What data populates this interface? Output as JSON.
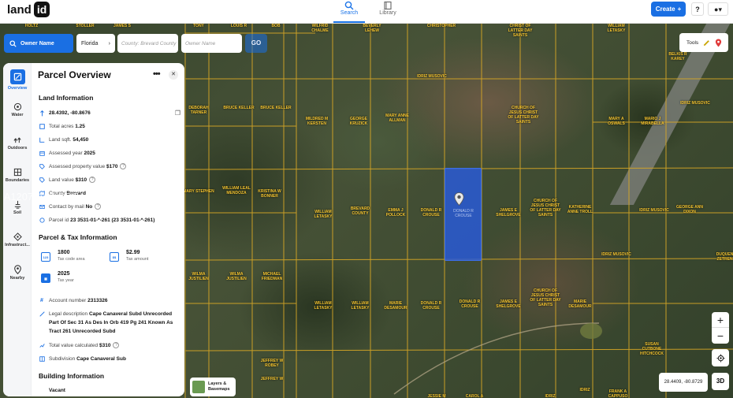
{
  "header": {
    "logo_text": "land",
    "logo_badge": "id",
    "tabs": [
      {
        "label": "Search",
        "active": true
      },
      {
        "label": "Library",
        "active": false
      }
    ],
    "create_label": "Create",
    "help_label": "?",
    "user_icon": "user-icon"
  },
  "search": {
    "mode_label": "Owner Name",
    "state": "Florida",
    "county_placeholder": "County: Brevard County",
    "owner_placeholder": "Owner Name",
    "go_label": "GO"
  },
  "tools": {
    "label": "Tools"
  },
  "map": {
    "selected_label": "DONALD R CROUSE",
    "owners": [
      "HOLTZ",
      "STOLLER",
      "JAMES S",
      "TONY",
      "LOUIS R",
      "BOB",
      "WILFRID CHALME",
      "BEVERLY LEHEW",
      "CHRISTOPHER",
      "CHRIST OF LATTER DAY SAINTS",
      "WILLIAM LETASKY",
      "BELKIS R KAREY",
      "IDRIZ MUSOVIC",
      "DEBORAH TARNER",
      "BRUCE KELLER",
      "BRUCE KELLER",
      "MILDRED M KERSTEN",
      "GEORGE KRUZICK",
      "MARY ANNE ALLMAN",
      "CHURCH OF JESUS CHRIST OF LATTER DAY SAINTS",
      "MARY A OSWALS",
      "MARIO J MIRABELLA",
      "IDRIZ MUSOVIC",
      "MARY STEPHEN",
      "WILLIAM LEAL MENDOZA",
      "KRISTINA W BONNER",
      "WILLIAM LETASKY",
      "BREVARD COUNTY",
      "EMMA J POLLOCK",
      "DONALD R CROUSE",
      "JAMES E SHELGROVE",
      "CHURCH OF JESUS CHRIST OF LATTER DAY SAINTS",
      "KATHERINE ANNE TROLL",
      "IDRIZ MUSOVIC",
      "GEORGE ANN DIXON",
      "IDRIZ MUSOVIC",
      "DUQUENNE ZETRENNE",
      "WILMA JUSTILIEN",
      "WILMA JUSTILIEN",
      "MICHAEL FRIEDMAN",
      "WILLIAM LETASKY",
      "WILLIAM LETASKY",
      "MARIE DESAMOUR",
      "DONALD R CROUSE",
      "DONALD R CROUSE",
      "JAMES E SHELGROVE",
      "CHURCH OF JESUS CHRIST OF LATTER DAY SAINTS",
      "MARIE DESAMOUR",
      "SUSAN CUTBONE HITCHCOCK",
      "JEFFREY W ROBEY",
      "JEFFREY W",
      "JESSIE M",
      "CAROL A",
      "IDRIZ",
      "IDRIZ",
      "FRANK A CAPPUSO"
    ]
  },
  "watermark": "A12071136 ©BEACHESMLS© 2026",
  "coords_readout": "28.4409, -80.8729",
  "layers": {
    "label_line1": "Layers &",
    "label_line2": "Basemaps"
  },
  "controls": {
    "zoom_in": "+",
    "zoom_out": "−",
    "three_d": "3D"
  },
  "rail": [
    {
      "label": "Overview",
      "icon": "overview-icon",
      "active": true
    },
    {
      "label": "Water",
      "icon": "water-icon",
      "active": false
    },
    {
      "label": "Outdoors",
      "icon": "outdoors-icon",
      "active": false
    },
    {
      "label": "Boundaries",
      "icon": "boundaries-icon",
      "active": false
    },
    {
      "label": "Soil",
      "icon": "soil-icon",
      "active": false
    },
    {
      "label": "Infrastruct...",
      "icon": "infrastructure-icon",
      "active": false
    },
    {
      "label": "Nearby",
      "icon": "nearby-icon",
      "active": false
    }
  ],
  "panel": {
    "title": "Parcel Overview",
    "land_info": {
      "heading": "Land Information",
      "coordinates": "28.4392, -80.8676",
      "total_acres_label": "Total acres",
      "total_acres": "1.25",
      "land_sqft_label": "Land sqft.",
      "land_sqft": "54,450",
      "assessed_year_label": "Assessed year",
      "assessed_year": "2025",
      "assessed_value_label": "Assessed property value",
      "assessed_value": "$170",
      "land_value_label": "Land value",
      "land_value": "$310",
      "county_label": "County",
      "county": "Brevard",
      "contact_label": "Contact by mail",
      "contact": "No",
      "parcel_id_label": "Parcel id",
      "parcel_id": "23 3531-01-*-261 (23 3531-01-*-261)"
    },
    "tax_info": {
      "heading": "Parcel & Tax Information",
      "tax_code_area": "1800",
      "tax_code_area_label": "Tax code area",
      "tax_amount": "$2.99",
      "tax_amount_label": "Tax amount",
      "tax_year": "2025",
      "tax_year_label": "Tax year",
      "account_label": "Account number",
      "account": "2313326",
      "legal_label": "Legal description",
      "legal": "Cape Canaveral Subd Unrecorded Part Of Sec 31 As Des In Orb 419 Pg 241 Known As Tract 261 Unrecorded Subd",
      "total_value_label": "Total value calculated",
      "total_value": "$310",
      "subdivision_label": "Subdivision",
      "subdivision": "Cape Canaveral Sub"
    },
    "building_info": {
      "heading": "Building Information",
      "status": "Vacant"
    }
  },
  "colors": {
    "accent": "#1a6fe3",
    "parcel_line": "#d9a825",
    "owner_label": "#f4c430",
    "selected_fill": "#2a5adc"
  }
}
